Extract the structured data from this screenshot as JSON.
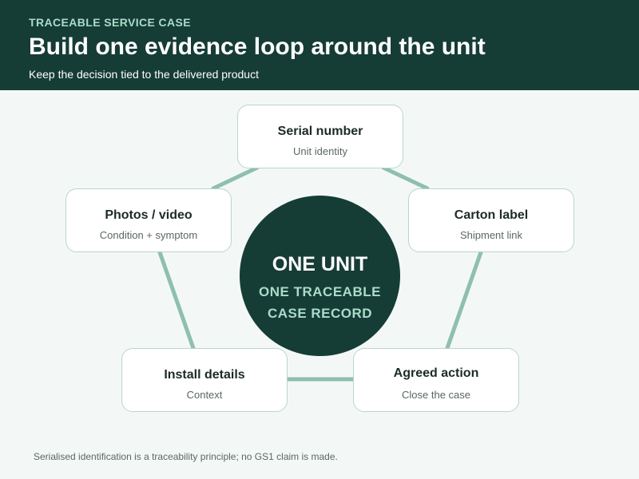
{
  "header": {
    "eyebrow": "TRACEABLE SERVICE CASE",
    "title": "Build one evidence loop around the unit",
    "subtitle": "Keep the decision tied to the delivered product"
  },
  "hub": {
    "title": "ONE UNIT",
    "subtitle": "ONE TRACEABLE CASE RECORD"
  },
  "nodes": [
    {
      "label": "Serial number",
      "sub": "Unit identity"
    },
    {
      "label": "Carton label",
      "sub": "Shipment link"
    },
    {
      "label": "Agreed action",
      "sub": "Close the case"
    },
    {
      "label": "Install details",
      "sub": "Context"
    },
    {
      "label": "Photos / video",
      "sub": "Condition + symptom"
    }
  ],
  "footnote": "Serialised identification is a traceability principle; no GS1 claim is made.",
  "colors": {
    "header_bg": "#163c36",
    "accent": "#a9dcc9",
    "connector": "#8fbfae",
    "card_border": "#b9d6cc",
    "background": "#f3f8f6"
  }
}
